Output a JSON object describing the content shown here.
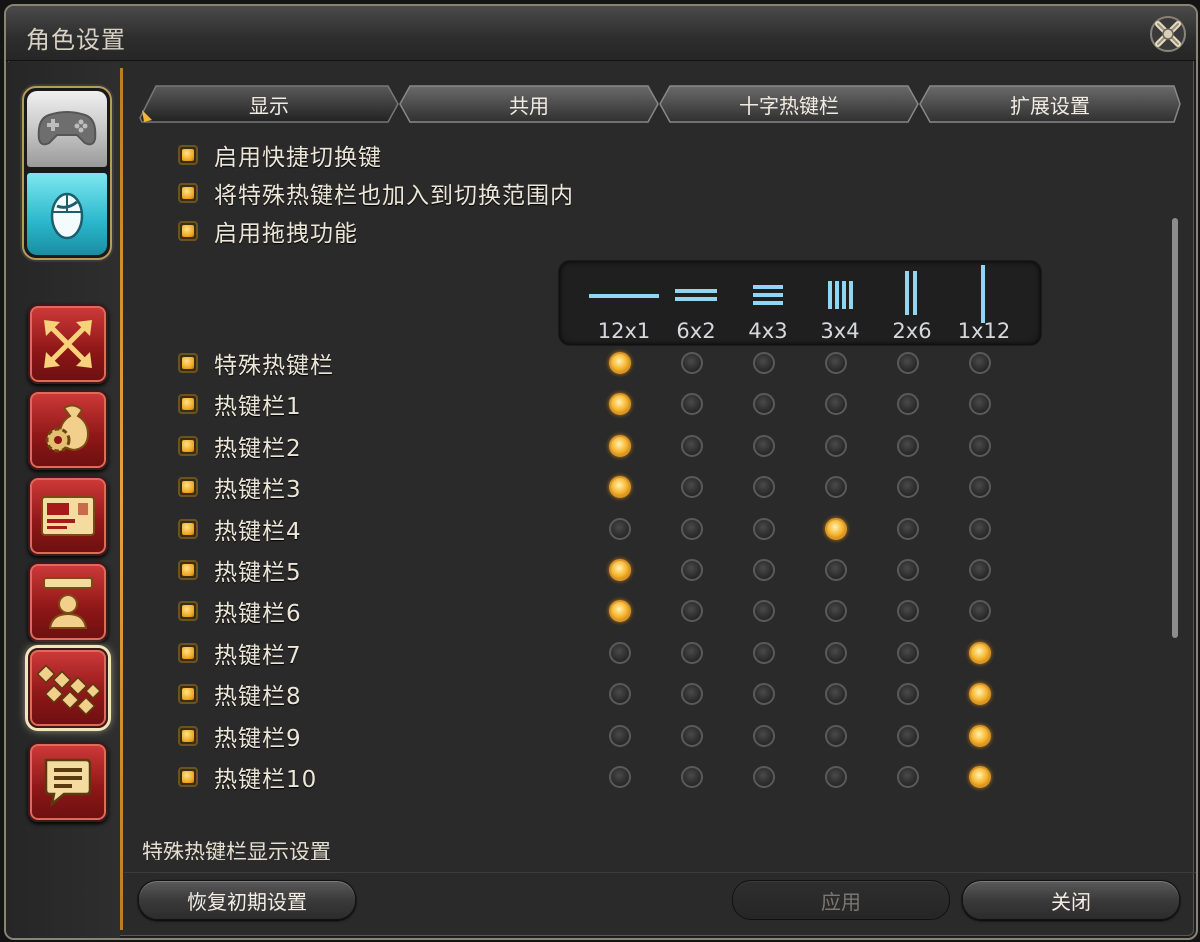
{
  "window": {
    "title": "角色设置"
  },
  "tabs": [
    {
      "label": "显示",
      "active": true
    },
    {
      "label": "共用",
      "active": false
    },
    {
      "label": "十字热键栏",
      "active": false
    },
    {
      "label": "扩展设置",
      "active": false
    }
  ],
  "options": [
    {
      "label": "启用快捷切换键",
      "checked": true
    },
    {
      "label": "将特殊热键栏也加入到切换范围内",
      "checked": true
    },
    {
      "label": "启用拖拽功能",
      "checked": true
    }
  ],
  "layouts": [
    "12x1",
    "6x2",
    "4x3",
    "3x4",
    "2x6",
    "1x12"
  ],
  "hotbars": [
    {
      "label": "特殊热键栏",
      "checked": true,
      "selected_layout": "12x1"
    },
    {
      "label": "热键栏1",
      "checked": true,
      "selected_layout": "12x1"
    },
    {
      "label": "热键栏2",
      "checked": true,
      "selected_layout": "12x1"
    },
    {
      "label": "热键栏3",
      "checked": true,
      "selected_layout": "12x1"
    },
    {
      "label": "热键栏4",
      "checked": true,
      "selected_layout": "3x4"
    },
    {
      "label": "热键栏5",
      "checked": true,
      "selected_layout": "12x1"
    },
    {
      "label": "热键栏6",
      "checked": true,
      "selected_layout": "12x1"
    },
    {
      "label": "热键栏7",
      "checked": true,
      "selected_layout": "1x12"
    },
    {
      "label": "热键栏8",
      "checked": true,
      "selected_layout": "1x12"
    },
    {
      "label": "热键栏9",
      "checked": true,
      "selected_layout": "1x12"
    },
    {
      "label": "热键栏10",
      "checked": true,
      "selected_layout": "1x12"
    }
  ],
  "section": {
    "title": "特殊热键栏显示设置"
  },
  "buttons": {
    "reset": "恢复初期设置",
    "apply": "应用",
    "close": "关闭"
  },
  "colors": {
    "accent": "#f5b22a",
    "divider": "#e1a53a",
    "layout_icon": "#8fd6f2",
    "side_button": "#b52424"
  }
}
